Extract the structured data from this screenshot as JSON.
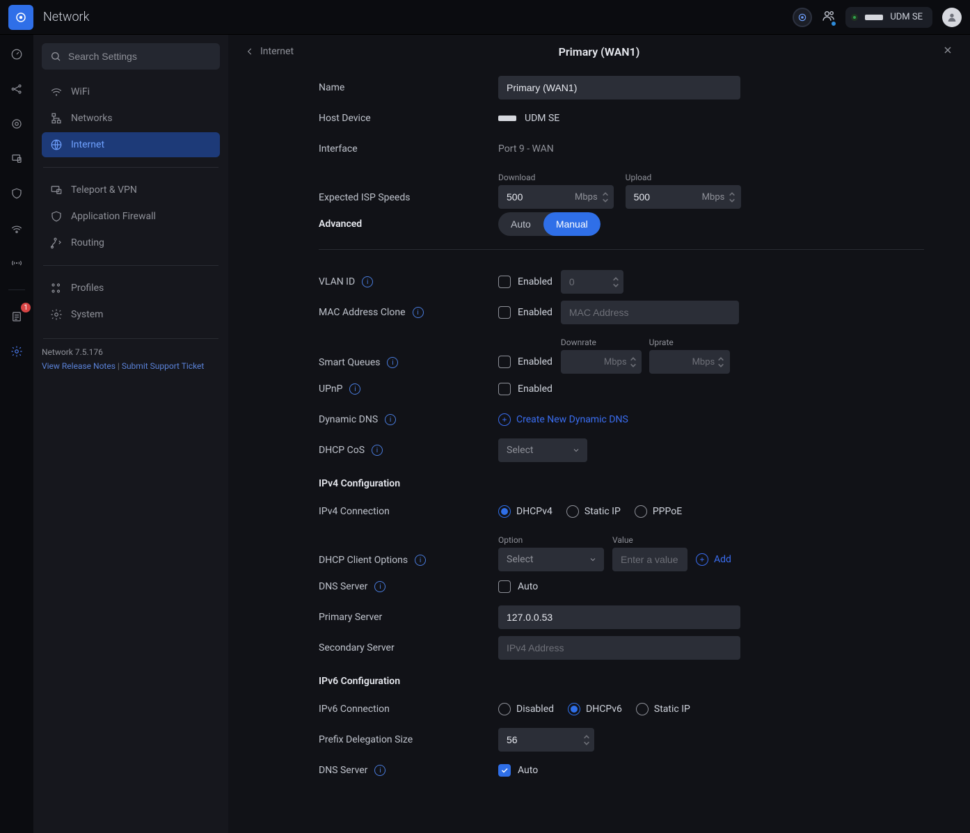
{
  "app": {
    "title": "Network",
    "device_name": "UDM SE"
  },
  "rail": {
    "badge": "1"
  },
  "sidebar": {
    "search_ph": "Search Settings",
    "items": [
      {
        "label": "WiFi"
      },
      {
        "label": "Networks"
      },
      {
        "label": "Internet"
      },
      {
        "label": "Teleport & VPN"
      },
      {
        "label": "Application Firewall"
      },
      {
        "label": "Routing"
      },
      {
        "label": "Profiles"
      },
      {
        "label": "System"
      }
    ],
    "version": "Network 7.5.176",
    "release_notes": "View Release Notes",
    "sep": "|",
    "support": "Submit Support Ticket"
  },
  "header": {
    "back": "Internet",
    "title": "Primary (WAN1)"
  },
  "form": {
    "name_label": "Name",
    "name_value": "Primary (WAN1)",
    "host_label": "Host Device",
    "host_value": "UDM SE",
    "iface_label": "Interface",
    "iface_value": "Port 9 - WAN",
    "speed_label": "Expected ISP Speeds",
    "download_label": "Download",
    "upload_label": "Upload",
    "download_value": "500",
    "upload_value": "500",
    "mbps": "Mbps",
    "advanced_label": "Advanced",
    "seg_auto": "Auto",
    "seg_manual": "Manual",
    "vlan_label": "VLAN ID",
    "enabled_label": "Enabled",
    "vlan_ph": "0",
    "mac_label": "MAC Address Clone",
    "mac_ph": "MAC Address",
    "sq_label": "Smart Queues",
    "downrate_label": "Downrate",
    "uprate_label": "Uprate",
    "upnp_label": "UPnP",
    "ddns_label": "Dynamic DNS",
    "ddns_link": "Create New Dynamic DNS",
    "cos_label": "DHCP CoS",
    "select_ph": "Select",
    "ipv4_section": "IPv4 Configuration",
    "ipv4_conn_label": "IPv4 Connection",
    "ipv4_opt_dhcp": "DHCPv4",
    "ipv4_opt_static": "Static IP",
    "ipv4_opt_pppoe": "PPPoE",
    "dhcp_opt_label": "DHCP Client Options",
    "option_label": "Option",
    "value_label": "Value",
    "value_ph": "Enter a value",
    "add_label": "Add",
    "dns_label": "DNS Server",
    "auto_label": "Auto",
    "primary_server_label": "Primary Server",
    "primary_server_value": "127.0.0.53",
    "secondary_server_label": "Secondary Server",
    "secondary_ph": "IPv4 Address",
    "ipv6_section": "IPv6 Configuration",
    "ipv6_conn_label": "IPv6 Connection",
    "ipv6_opt_disabled": "Disabled",
    "ipv6_opt_dhcp": "DHCPv6",
    "ipv6_opt_static": "Static IP",
    "prefix_label": "Prefix Delegation Size",
    "prefix_value": "56"
  }
}
